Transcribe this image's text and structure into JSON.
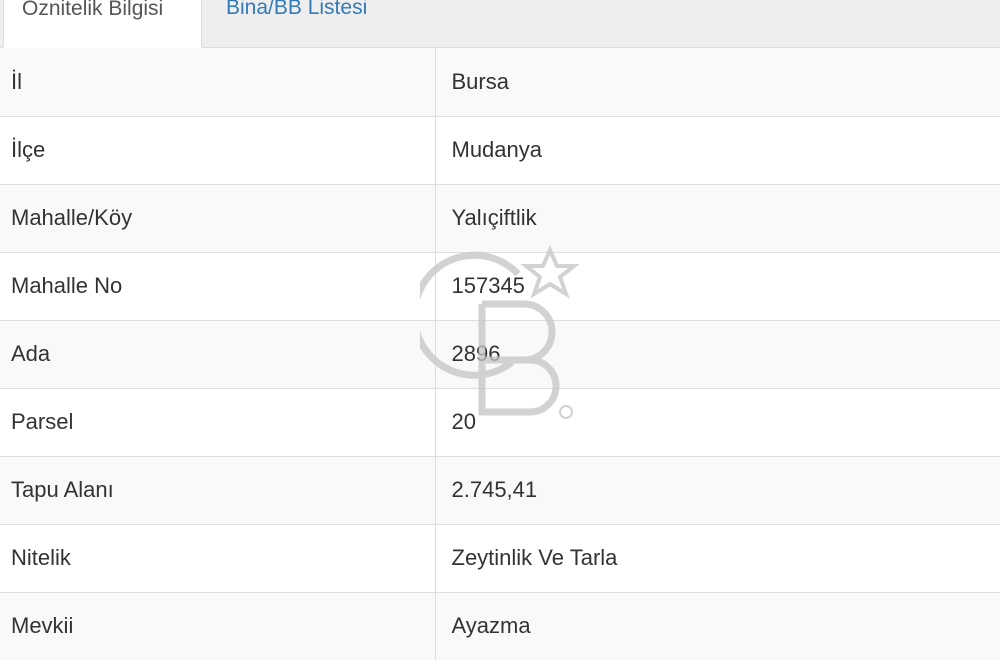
{
  "tabs": [
    {
      "label": "Öznitelik Bilgisi",
      "active": true
    },
    {
      "label": "Bina/BB Listesi",
      "active": false
    }
  ],
  "rows": [
    {
      "key": "İl",
      "value": "Bursa"
    },
    {
      "key": "İlçe",
      "value": "Mudanya"
    },
    {
      "key": "Mahalle/Köy",
      "value": "Yalıçiftlik"
    },
    {
      "key": "Mahalle No",
      "value": "157345"
    },
    {
      "key": "Ada",
      "value": "2896"
    },
    {
      "key": "Parsel",
      "value": "20"
    },
    {
      "key": "Tapu Alanı",
      "value": "2.745,41"
    },
    {
      "key": "Nitelik",
      "value": "Zeytinlik Ve Tarla"
    },
    {
      "key": "Mevkii",
      "value": "Ayazma"
    }
  ],
  "watermark": {
    "icon": "cb-logo-watermark",
    "color": "#bdbdbd"
  },
  "colors": {
    "link": "#337ab7",
    "border": "#dddddd",
    "stripe": "#f9f9f9",
    "tabbar": "#eeeeee"
  }
}
